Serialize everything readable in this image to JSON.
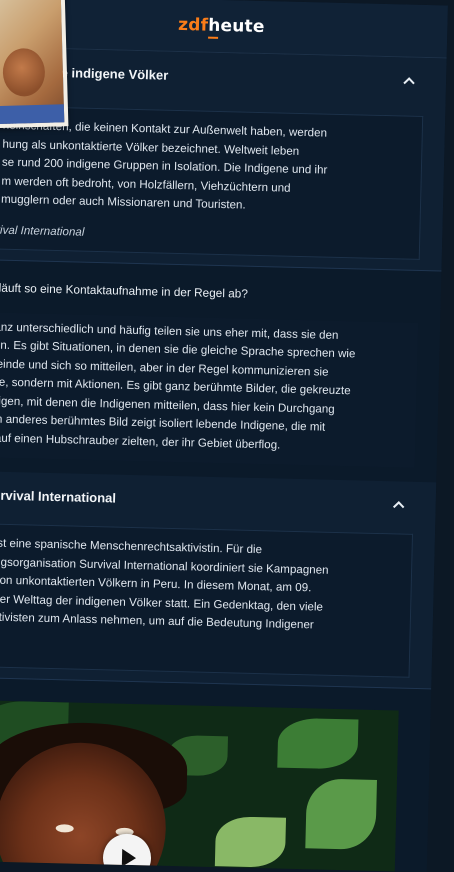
{
  "header": {
    "logo_zdf": "zdf",
    "logo_heute": "heute"
  },
  "section1": {
    "title": "ze indigene Völker",
    "paragraph": "neinschaften, die keinen Kontakt zur Außenwelt haben, werden\nhung als unkontaktierte Völker bezeichnet. Weltweit leben\nse rund 200 indigene Gruppen in Isolation. Die Indigene und ihr\nm werden oft bedroht, von Holzfällern, Viehzüchtern und\nmugglern oder auch Missionaren und Touristen.",
    "source": "rvival International"
  },
  "qa": {
    "question": "e läuft so eine Kontaktaufnahme in der Regel ab?",
    "answer": "ganz unterschiedlich und häufig teilen sie uns eher mit, dass sie den\nnen. Es gibt Situationen, in denen sie die gleiche Sprache sprechen wie\nmeinde und sich so mitteilen, aber in der Regel kommunizieren sie\nche, sondern mit Aktionen. Es gibt ganz berühmte Bilder, die gekreuzte\nzeigen, mit denen die Indigenen mitteilen, dass hier kein Durchgang\nEin anderes berühmtes Bild zeigt isoliert lebende Indigene, die mit\nn auf einen Hubschrauber zielten, der ihr Gebiet überflog."
  },
  "section2": {
    "title": "Survival International",
    "paragraph": "ist eine spanische Menschenrechtsaktivistin. Für die\nngsorganisation Survival International koordiniert sie Kampagnen\nvon unkontaktierten Völkern in Peru. In diesem Monat, am 09.\nder Welttag der indigenen Völker statt. Ein Gedenktag, den viele\nktivisten zum Anlass nehmen, um auf die Bedeutung Indigener"
  },
  "icons": {
    "collapse": "chevron-up-icon",
    "play": "play-icon"
  },
  "colors": {
    "brand_orange": "#fa7d19",
    "background": "#0b1a2a"
  }
}
